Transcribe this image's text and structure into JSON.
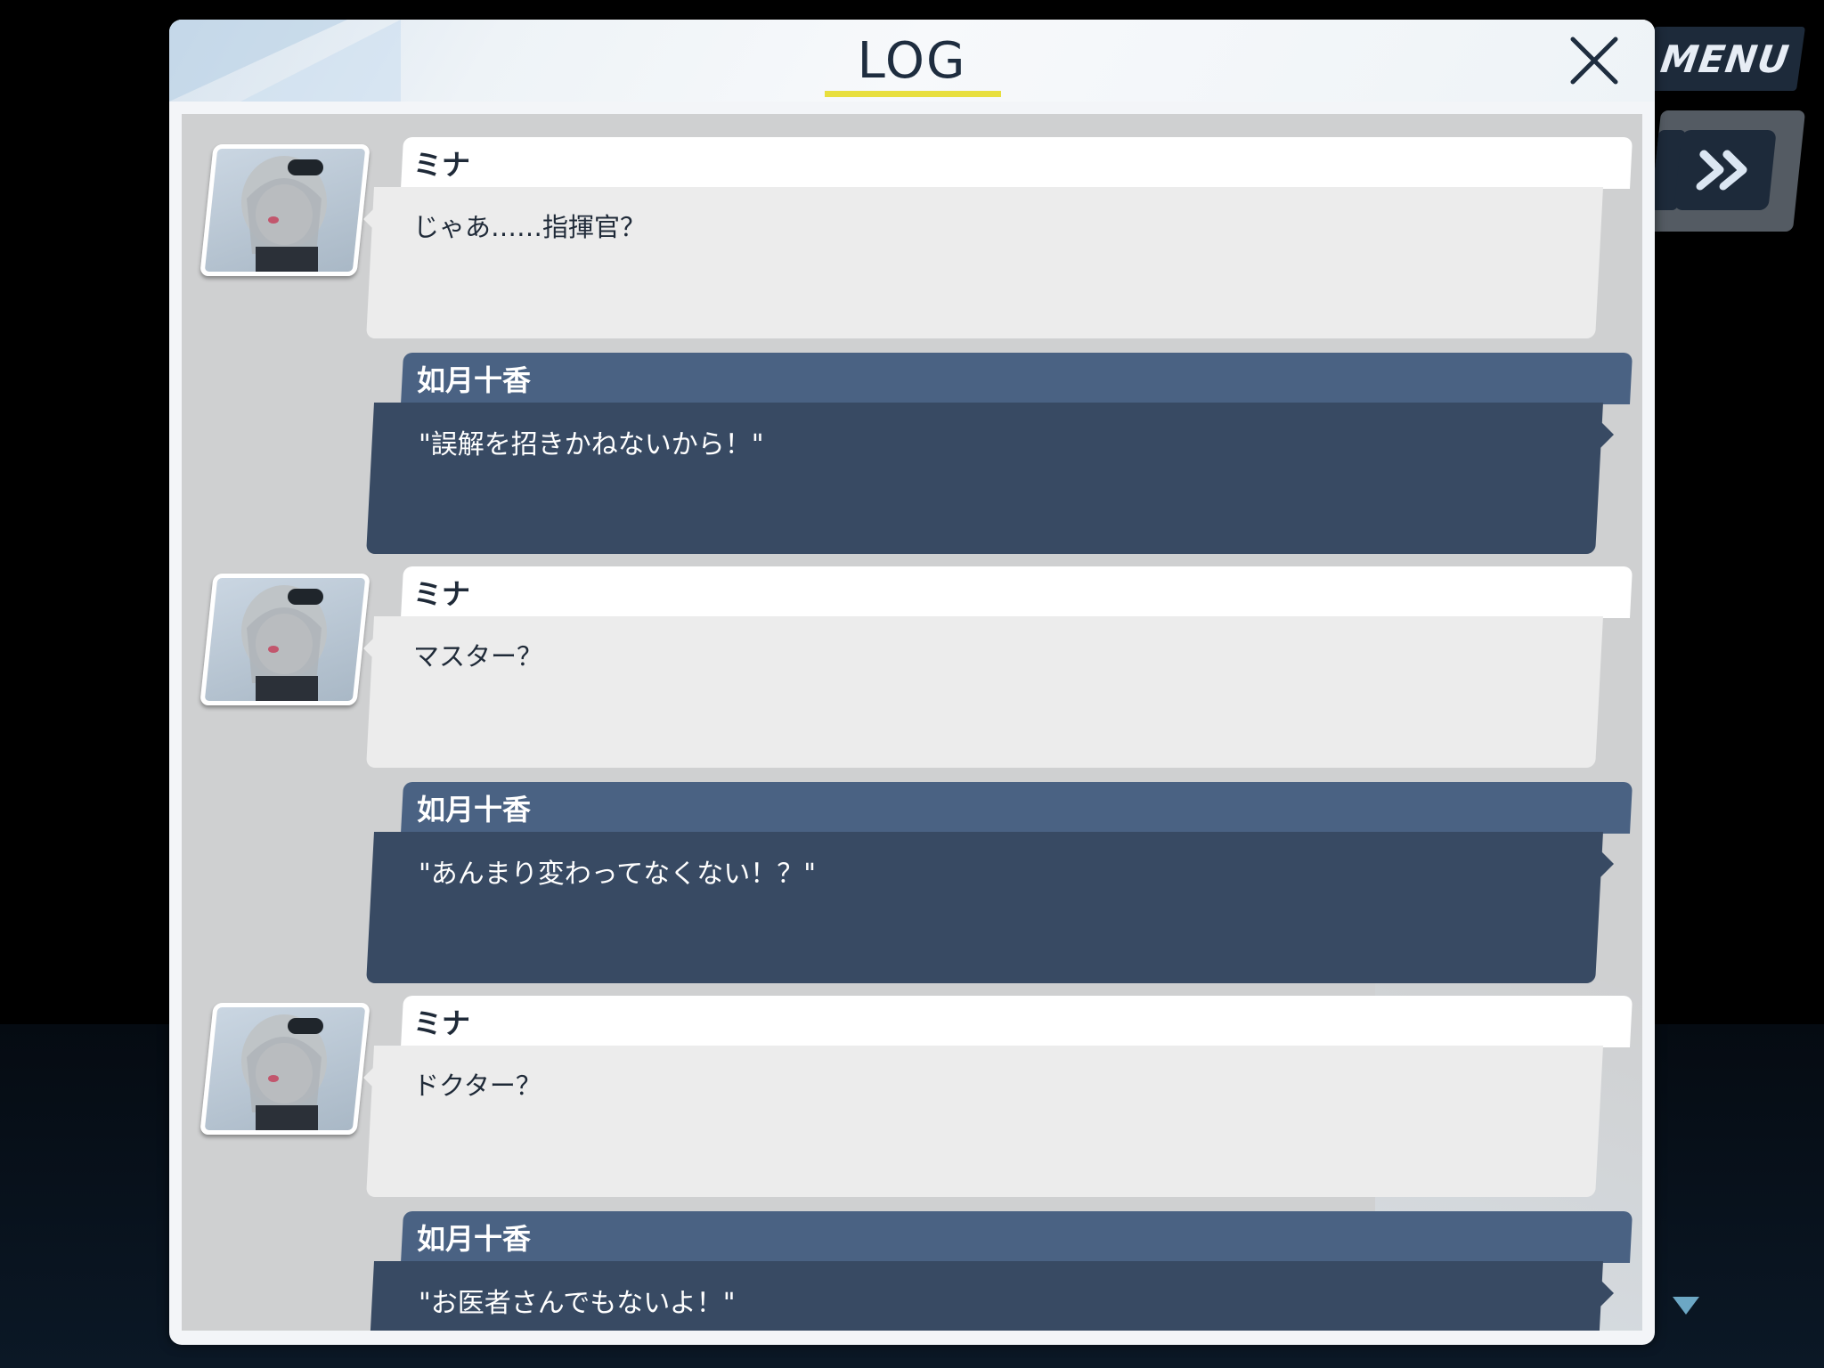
{
  "hud": {
    "menu_label": "MENU",
    "skip_icon": "fast-forward-icon",
    "scroll_icon": "triangle-down-icon"
  },
  "log_window": {
    "title": "LOG",
    "close_icon": "close-icon",
    "accent_color": "#e8df3e"
  },
  "entries": [
    {
      "speaker": "ミナ",
      "text": "じゃあ……指揮官？",
      "side": "npc",
      "avatar": "mina-portrait"
    },
    {
      "speaker": "如月十香",
      "text": "\"誤解を招きかねないから！\"",
      "side": "player"
    },
    {
      "speaker": "ミナ",
      "text": "マスター？",
      "side": "npc",
      "avatar": "mina-portrait"
    },
    {
      "speaker": "如月十香",
      "text": "\"あんまり変わってなくない！？\"",
      "side": "player"
    },
    {
      "speaker": "ミナ",
      "text": "ドクター？",
      "side": "npc",
      "avatar": "mina-portrait"
    },
    {
      "speaker": "如月十香",
      "text": "\"お医者さんでもないよ！\"",
      "side": "player"
    }
  ],
  "colors": {
    "npc_name_bar": "#ffffff",
    "npc_text_box": "#ececec",
    "player_name_bar": "#4a6283",
    "player_text_box": "#384a63"
  }
}
